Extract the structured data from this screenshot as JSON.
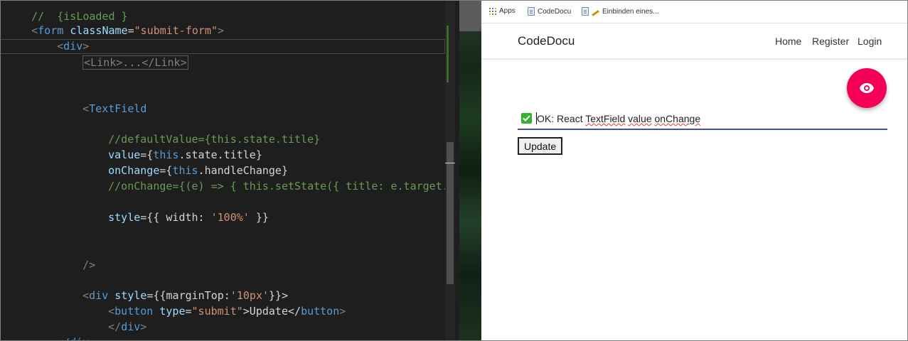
{
  "editor": {
    "line0": "//  {isLoaded }",
    "form_open": {
      "lt": "<",
      "tag": "form",
      "attr": "className",
      "eq": "=",
      "str": "\"submit-form\"",
      "gt": ">"
    },
    "div_open": {
      "lt": "<",
      "tag": "div",
      "gt": ">"
    },
    "link_fold": "<Link>...</Link>",
    "textfield_open": {
      "lt": "<",
      "tag": "TextField"
    },
    "comment_default_value": "//defaultValue={this.state.title}",
    "value_line": {
      "attr": "value",
      "pre": "={",
      "kw": "this",
      "post": ".state.title}"
    },
    "onchange_line": {
      "attr": "onChange",
      "pre": "={",
      "kw": "this",
      "post": ".handleChange}"
    },
    "comment_onchange": "//onChange={(e) => { this.setState({ title: e.target.va",
    "style_line": {
      "attr": "style",
      "pre": "={{ width: ",
      "str": "'100%'",
      "post": " }}"
    },
    "self_close": "/>",
    "div_style_line": {
      "lt": "<",
      "tag": "div",
      "attr": "style",
      "pre": "={{marginTop:",
      "str": "'10px'",
      "post": "}}>"
    },
    "button_line": {
      "lt": "<",
      "tag": "button",
      "attr": "type",
      "eq": "=",
      "str": "\"submit\"",
      "text": ">Update</",
      "tag2": "button",
      "gt": ">"
    },
    "div_close_inner": {
      "lt": "</",
      "tag": "div",
      "gt": ">"
    },
    "div_close_outer": {
      "lt": "</",
      "tag": "div",
      "gt": ">"
    }
  },
  "bookmarks": [
    {
      "label": "Apps",
      "icon": "apps-grid-icon"
    },
    {
      "label": "CodeDocu",
      "icon": "page-icon"
    },
    {
      "label": "Einbinden eines...",
      "icon": "page-pencil-icon"
    }
  ],
  "navbar": {
    "brand": "CodeDocu",
    "links": [
      "Home",
      "Register",
      "Login"
    ]
  },
  "fab": {
    "icon": "eye-icon",
    "color": "#f50057"
  },
  "textfield": {
    "prefix_icon": "check-mark-icon",
    "text_plain1": "OK: React ",
    "text_squiggle1": "TextField",
    "text_plain2": " ",
    "text_squiggle2": "value",
    "text_plain3": " ",
    "text_squiggle3": "onChange",
    "underline_color": "#3f51b5"
  },
  "update_button": {
    "label": "Update"
  }
}
